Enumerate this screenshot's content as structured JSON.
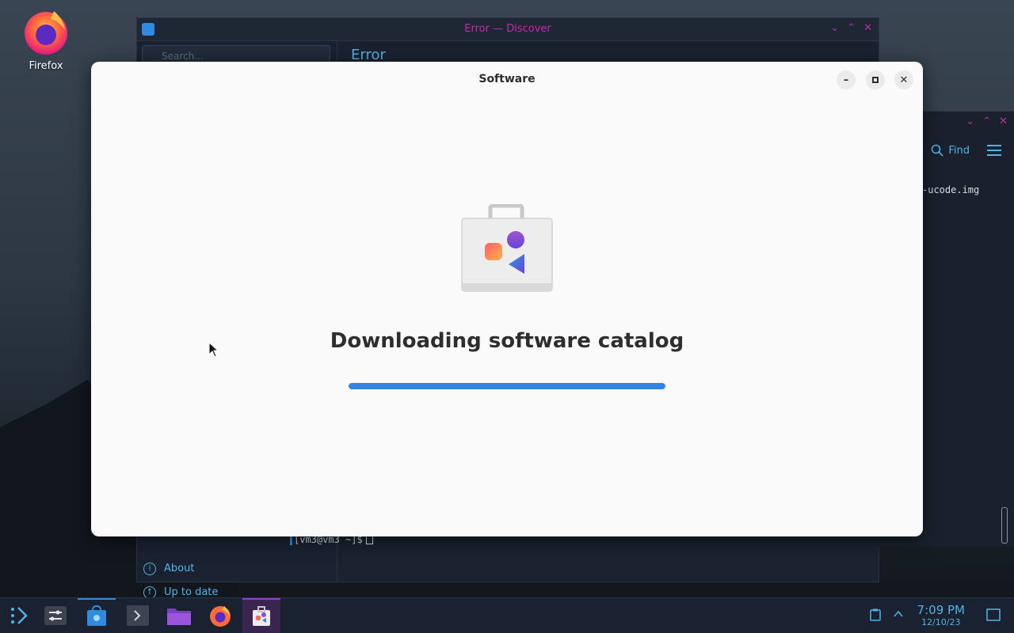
{
  "desktop": {
    "icons": [
      {
        "label": "Firefox",
        "icon": "firefox-icon"
      }
    ]
  },
  "discover_window": {
    "title": "Error — Discover",
    "search_placeholder": "Search...",
    "main_title": "Error",
    "sidebar_items": [
      {
        "label": "About",
        "icon": "info-icon"
      },
      {
        "label": "Up to date",
        "icon": "update-icon"
      }
    ]
  },
  "terminal_window": {
    "find_label": "Find",
    "visible_text": "-ucode.img",
    "prompt": "[vm3@vm3 ~]$"
  },
  "software_dialog": {
    "title": "Software",
    "headline": "Downloading software catalog",
    "progress": 1.0,
    "accent_color": "#3584e4"
  },
  "taskbar": {
    "items": [
      {
        "name": "application-launcher",
        "icon": "launcher-icon"
      },
      {
        "name": "system-settings",
        "icon": "settings-icon"
      },
      {
        "name": "discover",
        "icon": "discover-icon"
      },
      {
        "name": "terminal",
        "icon": "terminal-icon"
      },
      {
        "name": "file-manager",
        "icon": "folder-icon"
      },
      {
        "name": "firefox",
        "icon": "firefox-icon"
      },
      {
        "name": "software",
        "icon": "software-icon"
      }
    ],
    "clock": {
      "time": "7:09 PM",
      "date": "12/10/23"
    }
  }
}
